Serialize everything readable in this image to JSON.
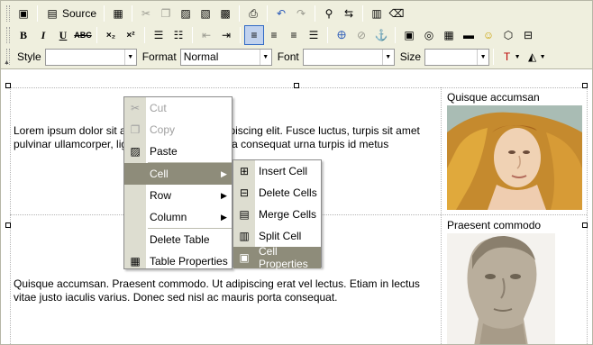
{
  "toolbar": {
    "source_label": "Source",
    "bold": "B",
    "italic": "I",
    "underline": "U",
    "strike": "ABC",
    "subscript": "×₂",
    "superscript": "×²",
    "style_label": "Style",
    "style_value": "",
    "format_label": "Format",
    "format_value": "Normal",
    "font_label": "Font",
    "font_value": "",
    "size_label": "Size",
    "size_value": ""
  },
  "content": {
    "paragraph_1": "Lorem ipsum dolor sit amet, consectetuer adipiscing elit. Fusce luctus, turpis sit amet pulvinar ullamcorper, ligula ligula porta ligula, a consequat urna turpis id metus",
    "paragraph_2": "Quisque accumsan. Praesent commodo. Ut adipiscing erat vel lectus. Etiam in lectus vitae justo iaculis varius. Donec sed nisl ac mauris porta consequat.",
    "caption_1": "Quisque accumsan",
    "caption_2": "Praesent commodo"
  },
  "context_menu": {
    "items": [
      "Cut",
      "Copy",
      "Paste",
      "Cell",
      "Row",
      "Column",
      "Delete Table",
      "Table Properties"
    ]
  },
  "cell_submenu": {
    "items": [
      "Insert Cell",
      "Delete Cells",
      "Merge Cells",
      "Split Cell",
      "Cell Properties"
    ]
  },
  "colors": {
    "toolbar_bg": "#efefde",
    "menu_highlight": "#8e8c7a",
    "active_button": "#c1d2ee"
  }
}
